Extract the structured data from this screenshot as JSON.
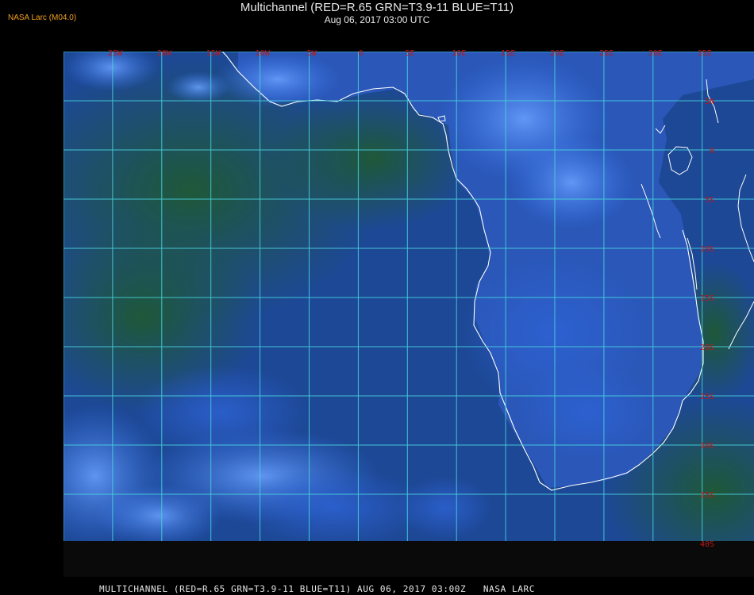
{
  "header": {
    "credit": "NASA Larc (M04.0)",
    "title": "Multichannel (RED=R.65 GRN=T3.9-11 BLUE=T11)",
    "subtitle": "Aug 06, 2017 03:00 UTC"
  },
  "footer": {
    "caption": "MULTICHANNEL (RED=R.65 GRN=T3.9-11 BLUE=T11) AUG 06, 2017 03:00Z   NASA LARC"
  },
  "map": {
    "longitude_labels": [
      "25W",
      "20W",
      "15W",
      "10W",
      "5W",
      "0",
      "5E",
      "10E",
      "15E",
      "20E",
      "25E",
      "30E",
      "35E"
    ],
    "latitude_labels": [
      "5N",
      "0",
      "5S",
      "10S",
      "15S",
      "20S",
      "25S",
      "30S",
      "35S",
      "40S"
    ],
    "colors": {
      "grid": "#46d2dc",
      "labels": "#c01818",
      "coast": "#ffffff",
      "ocean": "#1e4a9a",
      "land": "#1d5a32",
      "cloud": "#4a8cff"
    }
  }
}
